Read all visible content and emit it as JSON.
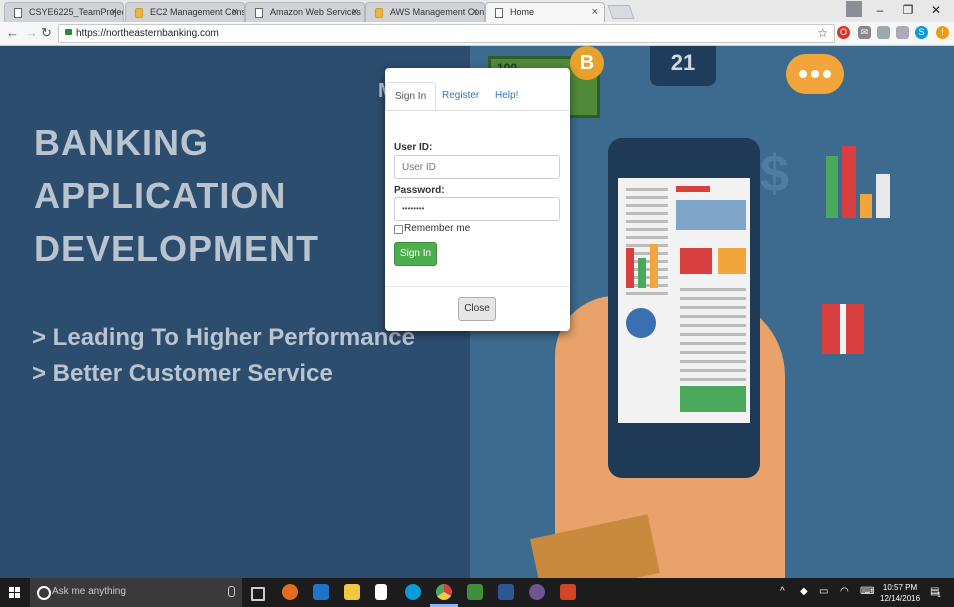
{
  "browser": {
    "tabs": [
      {
        "title": "CSYE6225_TeamProject_",
        "favicon": "document-icon"
      },
      {
        "title": "EC2 Management Conso",
        "favicon": "aws-icon"
      },
      {
        "title": "Amazon Web Services S",
        "favicon": "document-icon"
      },
      {
        "title": "AWS Management Cons",
        "favicon": "aws-icon"
      },
      {
        "title": "Home",
        "favicon": "document-icon",
        "active": true
      }
    ],
    "url": "https://northeasternbanking.com",
    "window_controls": {
      "minimize": "–",
      "restore": "❐",
      "close": "✕"
    }
  },
  "hero": {
    "title_lines": [
      "BANKING",
      "APPLICATION",
      "DEVELOPMENT"
    ],
    "taglines": [
      "> Leading To Higher Performance",
      "> Better Customer Service"
    ],
    "partial_letter": "M"
  },
  "modal": {
    "tabs": [
      "Sign In",
      "Register",
      "Help!"
    ],
    "user_id_label": "User ID:",
    "user_id_placeholder": "User ID",
    "password_label": "Password:",
    "password_value": "••••••••",
    "remember_label": "Remember me",
    "signin_button": "Sign In",
    "close_button": "Close"
  },
  "illustration": {
    "coin_symbol": "B",
    "counter_text": "21",
    "bill_text": "100",
    "dollar_symbol": "$"
  },
  "taskbar": {
    "search_placeholder": "Ask me anything",
    "time": "10:57 PM",
    "date": "12/14/2016",
    "notification_count": "1"
  },
  "colors": {
    "page_bg": "#2c4d6e",
    "signin_green": "#4cae4c",
    "link_blue": "#337ab7"
  }
}
